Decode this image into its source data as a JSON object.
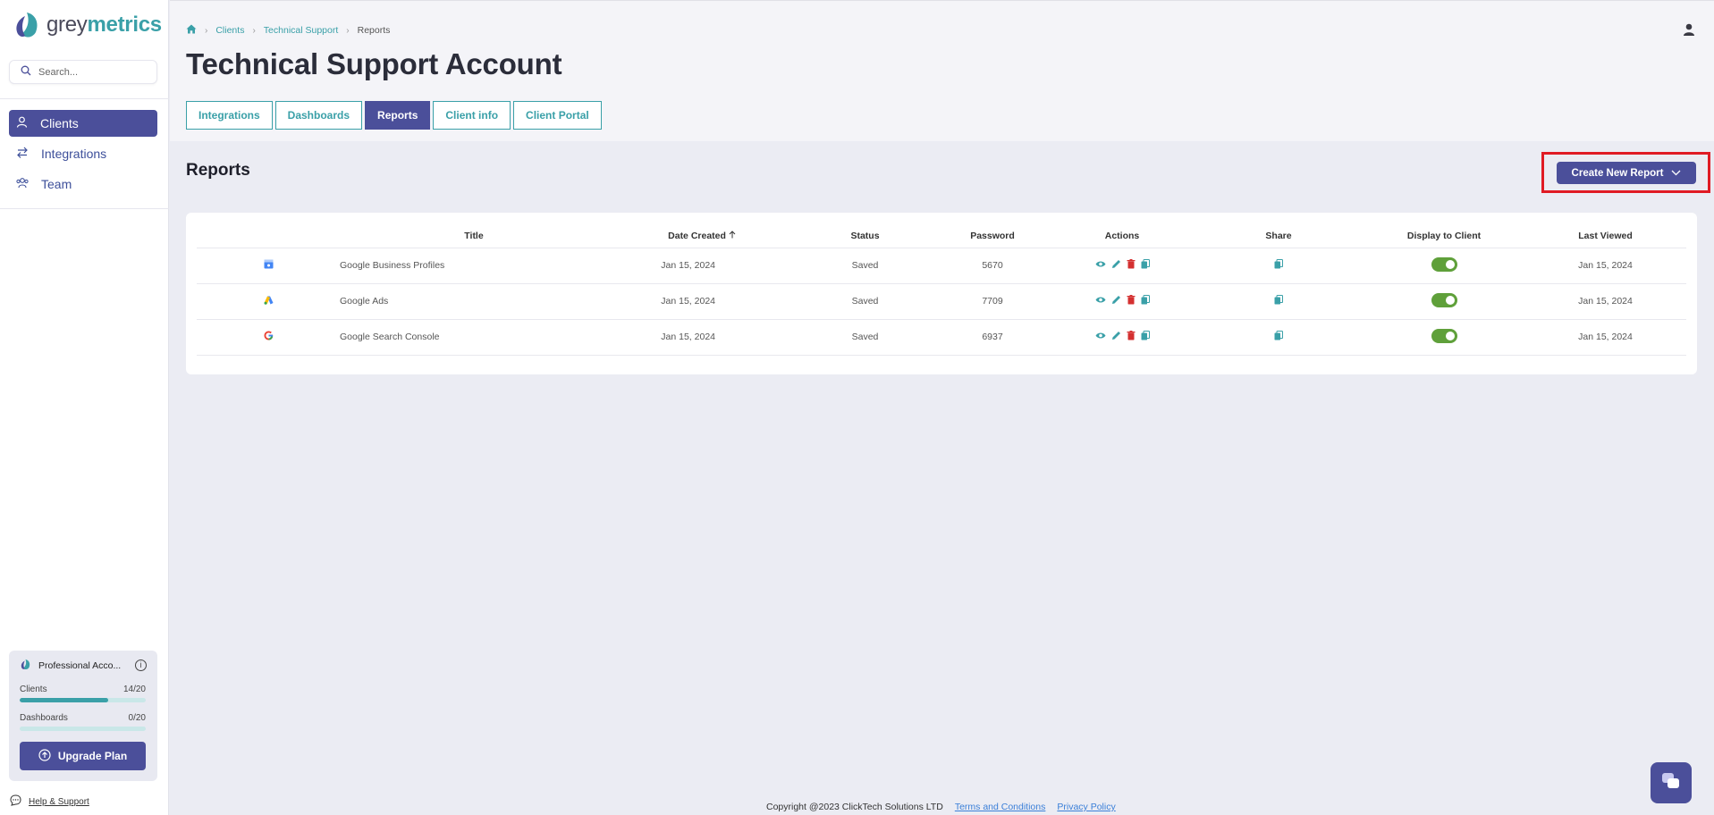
{
  "brand": {
    "grey": "grey",
    "metrics": "metrics"
  },
  "search": {
    "placeholder": "Search..."
  },
  "nav": [
    {
      "label": "Clients",
      "icon": "user-icon",
      "active": true
    },
    {
      "label": "Integrations",
      "icon": "arrows-swap-icon",
      "active": false
    },
    {
      "label": "Team",
      "icon": "team-icon",
      "active": false
    }
  ],
  "account": {
    "plan": "Professional Acco...",
    "clients_label": "Clients",
    "clients_value": "14/20",
    "clients_fraction": 0.7,
    "dashboards_label": "Dashboards",
    "dashboards_value": "0/20",
    "dashboards_fraction": 0.0,
    "upgrade_label": "Upgrade Plan"
  },
  "help": {
    "label": "Help & Support"
  },
  "breadcrumb": {
    "home_icon": "home-icon",
    "items": [
      "Clients",
      "Technical Support",
      "Reports"
    ]
  },
  "page": {
    "title": "Technical Support Account",
    "section_title": "Reports"
  },
  "tabs": [
    {
      "label": "Integrations",
      "active": false
    },
    {
      "label": "Dashboards",
      "active": false
    },
    {
      "label": "Reports",
      "active": true
    },
    {
      "label": "Client info",
      "active": false
    },
    {
      "label": "Client Portal",
      "active": false
    }
  ],
  "create_button": {
    "label": "Create New Report"
  },
  "table": {
    "headers": [
      "",
      "Title",
      "Date Created",
      "Status",
      "Password",
      "Actions",
      "Share",
      "Display to Client",
      "Last Viewed"
    ],
    "rows": [
      {
        "icon": "google-business-profile-icon",
        "title": "Google Business Profiles",
        "date": "Jan 15, 2024",
        "status": "Saved",
        "password": "5670",
        "display": true,
        "last_viewed": "Jan 15, 2024"
      },
      {
        "icon": "google-ads-icon",
        "title": "Google Ads",
        "date": "Jan 15, 2024",
        "status": "Saved",
        "password": "7709",
        "display": true,
        "last_viewed": "Jan 15, 2024"
      },
      {
        "icon": "google-search-console-icon",
        "title": "Google Search Console",
        "date": "Jan 15, 2024",
        "status": "Saved",
        "password": "6937",
        "display": true,
        "last_viewed": "Jan 15, 2024"
      }
    ]
  },
  "footer": {
    "copyright": "Copyright @2023 ClickTech Solutions LTD",
    "terms": "Terms and Conditions",
    "privacy": "Privacy Policy"
  },
  "colors": {
    "primary": "#4b4f9a",
    "teal": "#3aa0a8",
    "toggle_on": "#5fa03a",
    "highlight": "#e01b24",
    "delete": "#d43030"
  }
}
